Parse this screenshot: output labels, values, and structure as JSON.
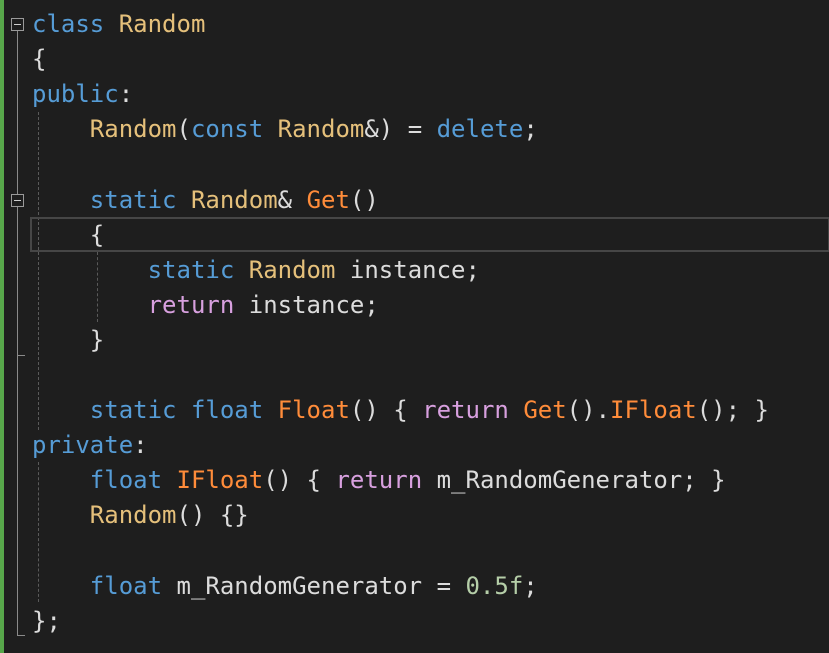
{
  "lines": [
    [
      {
        "t": "class",
        "c": "kw"
      },
      {
        "t": " ",
        "c": "op"
      },
      {
        "t": "Random",
        "c": "ty"
      }
    ],
    [
      {
        "t": "{",
        "c": "op"
      }
    ],
    [
      {
        "t": "public",
        "c": "kw"
      },
      {
        "t": ":",
        "c": "op"
      }
    ],
    [
      {
        "t": "    ",
        "c": "op"
      },
      {
        "t": "Random",
        "c": "ty"
      },
      {
        "t": "(",
        "c": "op"
      },
      {
        "t": "const",
        "c": "kw"
      },
      {
        "t": " ",
        "c": "op"
      },
      {
        "t": "Random",
        "c": "ty"
      },
      {
        "t": "&) = ",
        "c": "op"
      },
      {
        "t": "delete",
        "c": "kw"
      },
      {
        "t": ";",
        "c": "op"
      }
    ],
    [],
    [
      {
        "t": "    ",
        "c": "op"
      },
      {
        "t": "static",
        "c": "kw"
      },
      {
        "t": " ",
        "c": "op"
      },
      {
        "t": "Random",
        "c": "ty"
      },
      {
        "t": "& ",
        "c": "op"
      },
      {
        "t": "Get",
        "c": "fn"
      },
      {
        "t": "()",
        "c": "op"
      }
    ],
    [
      {
        "t": "    {",
        "c": "op"
      }
    ],
    [
      {
        "t": "        ",
        "c": "op"
      },
      {
        "t": "static",
        "c": "kw"
      },
      {
        "t": " ",
        "c": "op"
      },
      {
        "t": "Random",
        "c": "ty"
      },
      {
        "t": " instance;",
        "c": "id"
      }
    ],
    [
      {
        "t": "        ",
        "c": "op"
      },
      {
        "t": "return",
        "c": "ctl"
      },
      {
        "t": " instance;",
        "c": "id"
      }
    ],
    [
      {
        "t": "    }",
        "c": "op"
      }
    ],
    [],
    [
      {
        "t": "    ",
        "c": "op"
      },
      {
        "t": "static",
        "c": "kw"
      },
      {
        "t": " ",
        "c": "op"
      },
      {
        "t": "float",
        "c": "kw"
      },
      {
        "t": " ",
        "c": "op"
      },
      {
        "t": "Float",
        "c": "fn"
      },
      {
        "t": "() { ",
        "c": "op"
      },
      {
        "t": "return",
        "c": "ctl"
      },
      {
        "t": " ",
        "c": "op"
      },
      {
        "t": "Get",
        "c": "fn"
      },
      {
        "t": "().",
        "c": "op"
      },
      {
        "t": "IFloat",
        "c": "fn"
      },
      {
        "t": "(); }",
        "c": "op"
      }
    ],
    [
      {
        "t": "private",
        "c": "kw"
      },
      {
        "t": ":",
        "c": "op"
      }
    ],
    [
      {
        "t": "    ",
        "c": "op"
      },
      {
        "t": "float",
        "c": "kw"
      },
      {
        "t": " ",
        "c": "op"
      },
      {
        "t": "IFloat",
        "c": "fn"
      },
      {
        "t": "() { ",
        "c": "op"
      },
      {
        "t": "return",
        "c": "ctl"
      },
      {
        "t": " m_RandomGenerator; }",
        "c": "id"
      }
    ],
    [
      {
        "t": "    ",
        "c": "op"
      },
      {
        "t": "Random",
        "c": "ty"
      },
      {
        "t": "() {}",
        "c": "op"
      }
    ],
    [],
    [
      {
        "t": "    ",
        "c": "op"
      },
      {
        "t": "float",
        "c": "kw"
      },
      {
        "t": " m_RandomGenerator = ",
        "c": "id"
      },
      {
        "t": "0.5f",
        "c": "num"
      },
      {
        "t": ";",
        "c": "op"
      }
    ],
    [
      {
        "t": "};",
        "c": "op"
      }
    ]
  ],
  "colors": {
    "background": "#1e1e1e",
    "keyword": "#569cd6",
    "type": "#e5c07b",
    "function": "#ff8c3a",
    "control": "#d8a0df",
    "text": "#dcdcdc",
    "number": "#b5cea8",
    "change_bar": "#57a64a"
  }
}
